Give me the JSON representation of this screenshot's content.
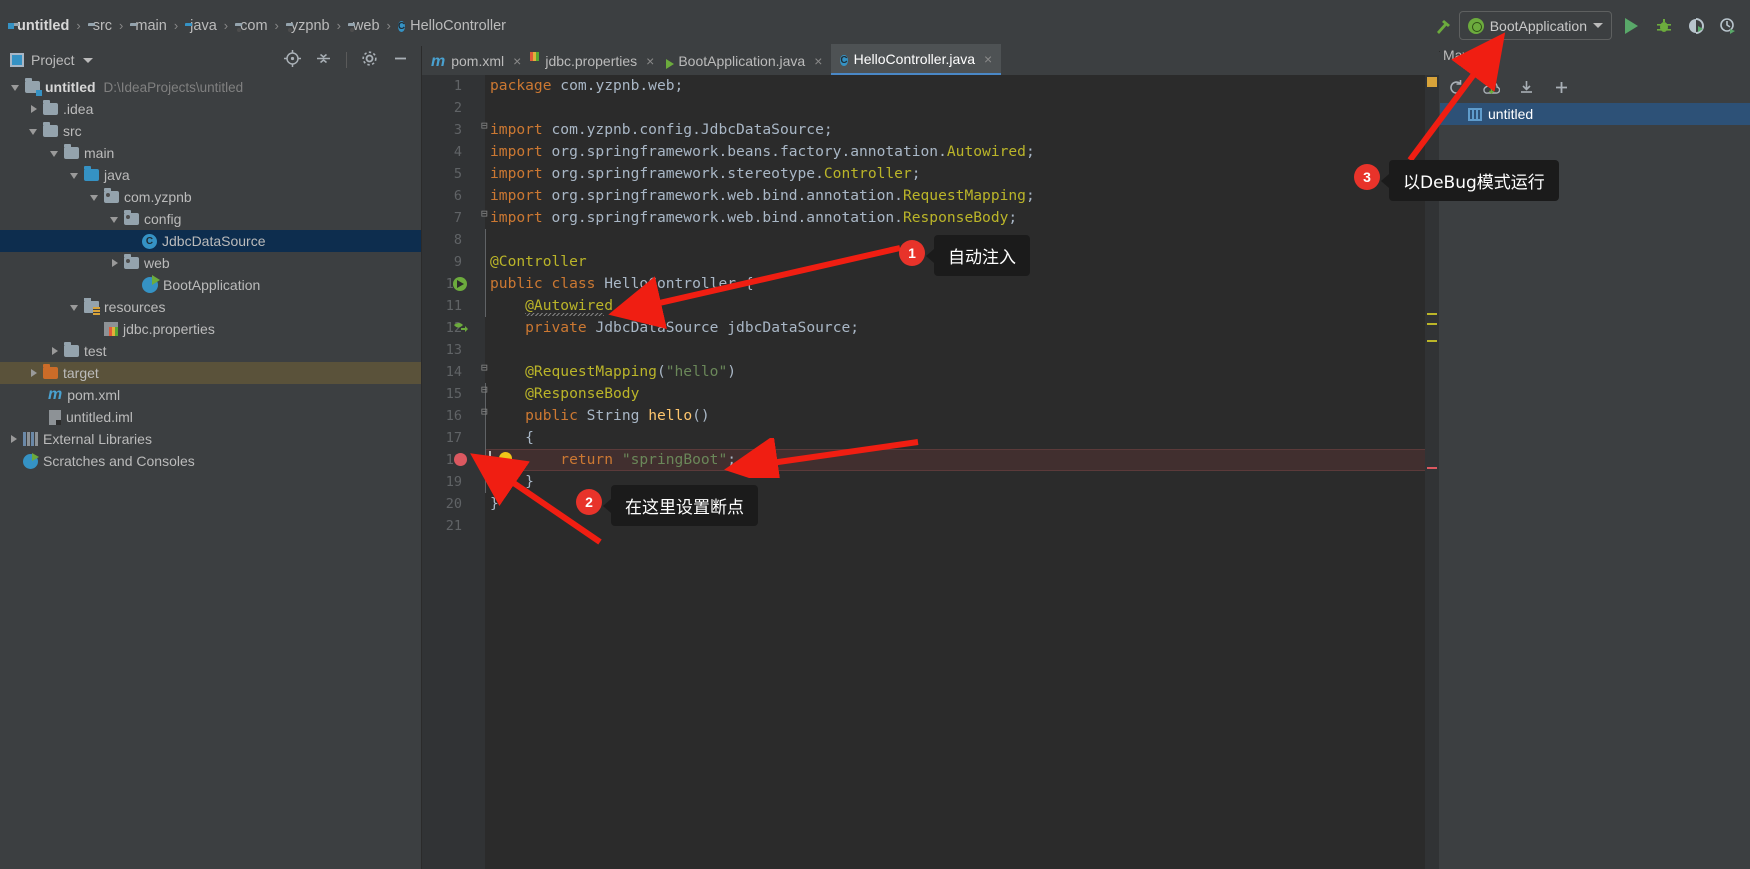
{
  "window": {
    "breadcrumbs": [
      {
        "label": "untitled",
        "icon": "module-folder-icon"
      },
      {
        "label": "src",
        "icon": "folder-icon"
      },
      {
        "label": "main",
        "icon": "folder-icon"
      },
      {
        "label": "java",
        "icon": "source-folder-icon"
      },
      {
        "label": "com",
        "icon": "package-icon"
      },
      {
        "label": "yzpnb",
        "icon": "package-icon"
      },
      {
        "label": "web",
        "icon": "package-icon"
      },
      {
        "label": "HelloController",
        "icon": "class-icon"
      }
    ],
    "separator": "›"
  },
  "toolbar": {
    "build_icon": "hammer-icon",
    "run_config": {
      "label": "BootApplication",
      "icon": "spring-boot-icon",
      "dropdown_icon": "chevron-down-icon"
    },
    "run_button": "run-icon",
    "debug_button": "debug-icon",
    "run_coverage_button": "run-with-coverage-icon",
    "profile_button": "profiler-icon"
  },
  "project_panel": {
    "title": "Project",
    "dropdown_icon": "chevron-down-icon",
    "actions": [
      "locate-icon",
      "collapse-all-icon",
      "settings-gear-icon",
      "hide-icon"
    ],
    "tree": [
      {
        "label": "untitled",
        "path": "D:\\IdeaProjects\\untitled",
        "indent": 0,
        "arrow": "down",
        "icon": "module-folder-icon",
        "bold": true
      },
      {
        "label": ".idea",
        "indent": 1,
        "arrow": "right",
        "icon": "folder-icon"
      },
      {
        "label": "src",
        "indent": 1,
        "arrow": "down",
        "icon": "folder-icon"
      },
      {
        "label": "main",
        "indent": 2,
        "arrow": "down",
        "icon": "folder-icon"
      },
      {
        "label": "java",
        "indent": 3,
        "arrow": "down",
        "icon": "source-folder-icon"
      },
      {
        "label": "com.yzpnb",
        "indent": 4,
        "arrow": "down",
        "icon": "package-icon"
      },
      {
        "label": "config",
        "indent": 5,
        "arrow": "down",
        "icon": "package-icon"
      },
      {
        "label": "JdbcDataSource",
        "indent": 6,
        "arrow": "none",
        "icon": "class-icon",
        "selected": true
      },
      {
        "label": "web",
        "indent": 5,
        "arrow": "right",
        "icon": "package-icon"
      },
      {
        "label": "BootApplication",
        "indent": 5,
        "arrow": "none",
        "icon": "spring-boot-class-icon"
      },
      {
        "label": "resources",
        "indent": 3,
        "arrow": "down",
        "icon": "resources-folder-icon"
      },
      {
        "label": "jdbc.properties",
        "indent": 4,
        "arrow": "none",
        "icon": "properties-file-icon"
      },
      {
        "label": "test",
        "indent": 2,
        "arrow": "right",
        "icon": "folder-icon"
      },
      {
        "label": "target",
        "indent": 1,
        "arrow": "right",
        "icon": "excluded-folder-icon",
        "highlighted": true
      },
      {
        "label": "pom.xml",
        "indent": 1,
        "arrow": "none",
        "icon": "maven-file-icon"
      },
      {
        "label": "untitled.iml",
        "indent": 1,
        "arrow": "none",
        "icon": "iml-file-icon"
      },
      {
        "label": "External Libraries",
        "indent": 0,
        "arrow": "right",
        "icon": "libraries-icon"
      },
      {
        "label": "Scratches and Consoles",
        "indent": 0,
        "arrow": "none",
        "icon": "scratches-icon"
      }
    ]
  },
  "editor_tabs": [
    {
      "label": "pom.xml",
      "icon": "maven-file-icon",
      "close": "×",
      "active": false
    },
    {
      "label": "jdbc.properties",
      "icon": "properties-file-icon",
      "close": "×",
      "active": false
    },
    {
      "label": "BootApplication.java",
      "icon": "spring-boot-class-icon",
      "close": "×",
      "active": false
    },
    {
      "label": "HelloController.java",
      "icon": "class-icon",
      "close": "×",
      "active": true
    }
  ],
  "editor": {
    "filename": "HelloController.java",
    "line_numbers": [
      1,
      2,
      3,
      4,
      5,
      6,
      7,
      8,
      9,
      10,
      11,
      12,
      13,
      14,
      15,
      16,
      17,
      18,
      19,
      20,
      21
    ],
    "lines": [
      {
        "n": 1,
        "tokens": [
          {
            "t": "package",
            "c": "kw"
          },
          {
            "t": " com.yzpnb.web;",
            "c": "pln"
          }
        ]
      },
      {
        "n": 2,
        "tokens": []
      },
      {
        "n": 3,
        "tokens": [
          {
            "t": "import",
            "c": "kw"
          },
          {
            "t": " com.yzpnb.config.",
            "c": "pln"
          },
          {
            "t": "JdbcDataSource",
            "c": "type"
          },
          {
            "t": ";",
            "c": "pln"
          }
        ]
      },
      {
        "n": 4,
        "tokens": [
          {
            "t": "import",
            "c": "kw"
          },
          {
            "t": " org.springframework.beans.factory.annotation.",
            "c": "pln"
          },
          {
            "t": "Autowired",
            "c": "anno"
          },
          {
            "t": ";",
            "c": "pln"
          }
        ]
      },
      {
        "n": 5,
        "tokens": [
          {
            "t": "import",
            "c": "kw"
          },
          {
            "t": " org.springframework.stereotype.",
            "c": "pln"
          },
          {
            "t": "Controller",
            "c": "anno"
          },
          {
            "t": ";",
            "c": "pln"
          }
        ]
      },
      {
        "n": 6,
        "tokens": [
          {
            "t": "import",
            "c": "kw"
          },
          {
            "t": " org.springframework.web.bind.annotation.",
            "c": "pln"
          },
          {
            "t": "RequestMapping",
            "c": "anno"
          },
          {
            "t": ";",
            "c": "pln"
          }
        ]
      },
      {
        "n": 7,
        "tokens": [
          {
            "t": "import",
            "c": "kw"
          },
          {
            "t": " org.springframework.web.bind.annotation.",
            "c": "pln"
          },
          {
            "t": "ResponseBody",
            "c": "anno"
          },
          {
            "t": ";",
            "c": "pln"
          }
        ]
      },
      {
        "n": 8,
        "tokens": []
      },
      {
        "n": 9,
        "tokens": [
          {
            "t": "@Controller",
            "c": "anno"
          }
        ]
      },
      {
        "n": 10,
        "tokens": [
          {
            "t": "public class",
            "c": "kw"
          },
          {
            "t": " ",
            "c": "pln"
          },
          {
            "t": "HelloController",
            "c": "pln"
          },
          {
            "t": " {",
            "c": "pln"
          }
        ]
      },
      {
        "n": 11,
        "tokens": [
          {
            "t": "    @Autowired",
            "c": "anno"
          }
        ]
      },
      {
        "n": 12,
        "tokens": [
          {
            "t": "    private",
            "c": "kw"
          },
          {
            "t": " ",
            "c": "pln"
          },
          {
            "t": "JdbcDataSource",
            "c": "type"
          },
          {
            "t": " ",
            "c": "pln"
          },
          {
            "t": "jdbcDataSource",
            "c": "pln"
          },
          {
            "t": ";",
            "c": "pln"
          }
        ]
      },
      {
        "n": 13,
        "tokens": []
      },
      {
        "n": 14,
        "tokens": [
          {
            "t": "    @RequestMapping",
            "c": "anno"
          },
          {
            "t": "(",
            "c": "pln"
          },
          {
            "t": "\"hello\"",
            "c": "str"
          },
          {
            "t": ")",
            "c": "pln"
          }
        ]
      },
      {
        "n": 15,
        "tokens": [
          {
            "t": "    @ResponseBody",
            "c": "anno"
          }
        ]
      },
      {
        "n": 16,
        "tokens": [
          {
            "t": "    public",
            "c": "kw"
          },
          {
            "t": " ",
            "c": "pln"
          },
          {
            "t": "String",
            "c": "type"
          },
          {
            "t": " ",
            "c": "pln"
          },
          {
            "t": "hello",
            "c": "mth"
          },
          {
            "t": "()",
            "c": "pln"
          }
        ]
      },
      {
        "n": 17,
        "tokens": [
          {
            "t": "    {",
            "c": "pln"
          }
        ]
      },
      {
        "n": 18,
        "tokens": [
          {
            "t": "        return",
            "c": "kw"
          },
          {
            "t": " ",
            "c": "pln"
          },
          {
            "t": "\"springBoot\"",
            "c": "str"
          },
          {
            "t": ";",
            "c": "pln"
          }
        ],
        "breakpoint": true,
        "bulb": true,
        "highlight": true
      },
      {
        "n": 19,
        "tokens": [
          {
            "t": "    }",
            "c": "pln"
          }
        ]
      },
      {
        "n": 20,
        "tokens": [
          {
            "t": "}",
            "c": "pln"
          }
        ]
      },
      {
        "n": 21,
        "tokens": []
      }
    ],
    "gutter_icons": [
      {
        "line": 10,
        "icon": "spring-bean-icon"
      },
      {
        "line": 12,
        "icon": "spring-autowired-navigate-icon"
      },
      {
        "line": 18,
        "icon": "breakpoint-icon"
      },
      {
        "line": 18,
        "icon": "intention-bulb-icon"
      }
    ]
  },
  "maven_panel": {
    "title": "Maven",
    "actions": [
      "reimport-icon",
      "generate-sources-icon",
      "download-sources-icon",
      "add-maven-project-icon"
    ],
    "items": [
      {
        "label": "untitled",
        "icon": "maven-project-icon",
        "selected": true
      }
    ]
  },
  "annotations": [
    {
      "number": "1",
      "text": "自动注入"
    },
    {
      "number": "2",
      "text": "在这里设置断点"
    },
    {
      "number": "3",
      "text": "以DeBug模式运行"
    }
  ],
  "colors": {
    "accent_red": "#e8332a",
    "tab_underline": "#4a88c7",
    "selection": "#0d2d4e",
    "editor_bg": "#2b2b2b",
    "panel_bg": "#3c3f41",
    "breakpoint": "#db5860",
    "run_green": "#59a869"
  }
}
